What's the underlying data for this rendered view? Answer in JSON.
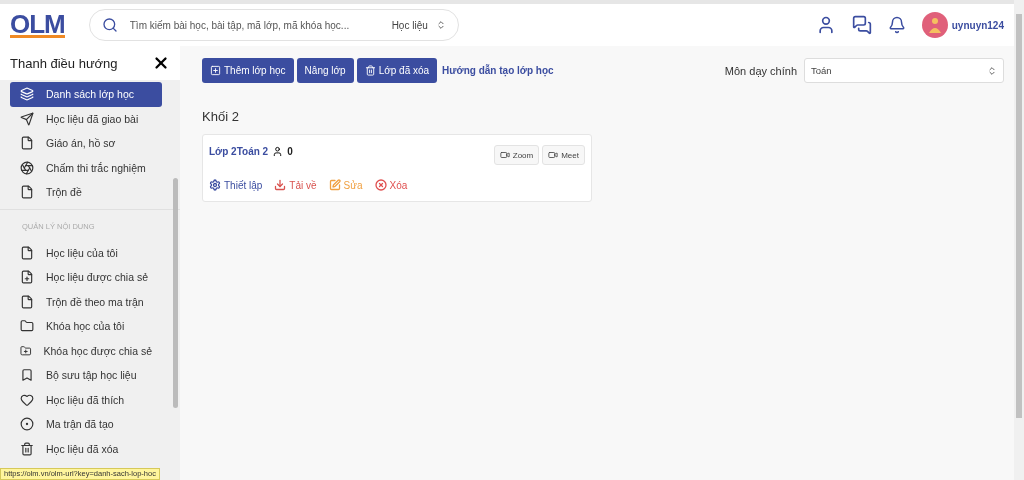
{
  "header": {
    "logo": "OLM",
    "search": {
      "placeholder": "Tìm kiếm bài học, bài tập, mã lớp, mã khóa học...",
      "scope": "Học liệu"
    },
    "username": "uynuyn124"
  },
  "sidebar": {
    "title": "Thanh điều hướng",
    "items": [
      {
        "label": "Danh sách lớp học",
        "selected": true
      },
      {
        "label": "Học liệu đã giao bài",
        "selected": false
      },
      {
        "label": "Giáo án, hồ sơ",
        "selected": false
      },
      {
        "label": "Chấm thi trắc nghiệm",
        "selected": false
      },
      {
        "label": "Trộn đề",
        "selected": false
      }
    ],
    "section_heading": "QUẢN LÝ NỘI DUNG",
    "section_items": [
      {
        "label": "Học liệu của tôi",
        "selected": false
      },
      {
        "label": "Học liệu được chia sẻ",
        "selected": false
      },
      {
        "label": "Trộn đề theo ma trận",
        "selected": false
      },
      {
        "label": "Khóa học của tôi",
        "selected": false
      },
      {
        "label": "Khóa học được chia sẻ",
        "selected": false
      },
      {
        "label": "Bộ sưu tập học liệu",
        "selected": false
      },
      {
        "label": "Học liệu đã thích",
        "selected": false
      },
      {
        "label": "Ma trận đã tạo",
        "selected": false
      },
      {
        "label": "Học liệu đã xóa",
        "selected": false
      }
    ]
  },
  "toolbar": {
    "buttons": [
      {
        "label": "Thêm lớp học",
        "kind": "add"
      },
      {
        "label": "Nâng lớp",
        "kind": "plain"
      },
      {
        "label": "Lớp đã xóa",
        "kind": "trash"
      }
    ],
    "guide_link": "Hướng dẫn tạo lớp học",
    "subject_label": "Môn dạy chính",
    "subject_value": "Toán"
  },
  "grade": {
    "title": "Khối 2",
    "classes": [
      {
        "name": "Lớp 2Toán 2",
        "students": "0",
        "meetings": [
          "Zoom",
          "Meet"
        ],
        "actions": [
          {
            "label": "Thiết lập",
            "kind": "settings",
            "color": "#3b4da0"
          },
          {
            "label": "Tải về",
            "kind": "download",
            "color": "#d9534f"
          },
          {
            "label": "Sửa",
            "kind": "edit",
            "color": "#f0a040"
          },
          {
            "label": "Xóa",
            "kind": "delete",
            "color": "#e05050"
          }
        ]
      }
    ]
  },
  "status_url": "https://olm.vn/olm-url?key=danh-sach-lop-hoc"
}
